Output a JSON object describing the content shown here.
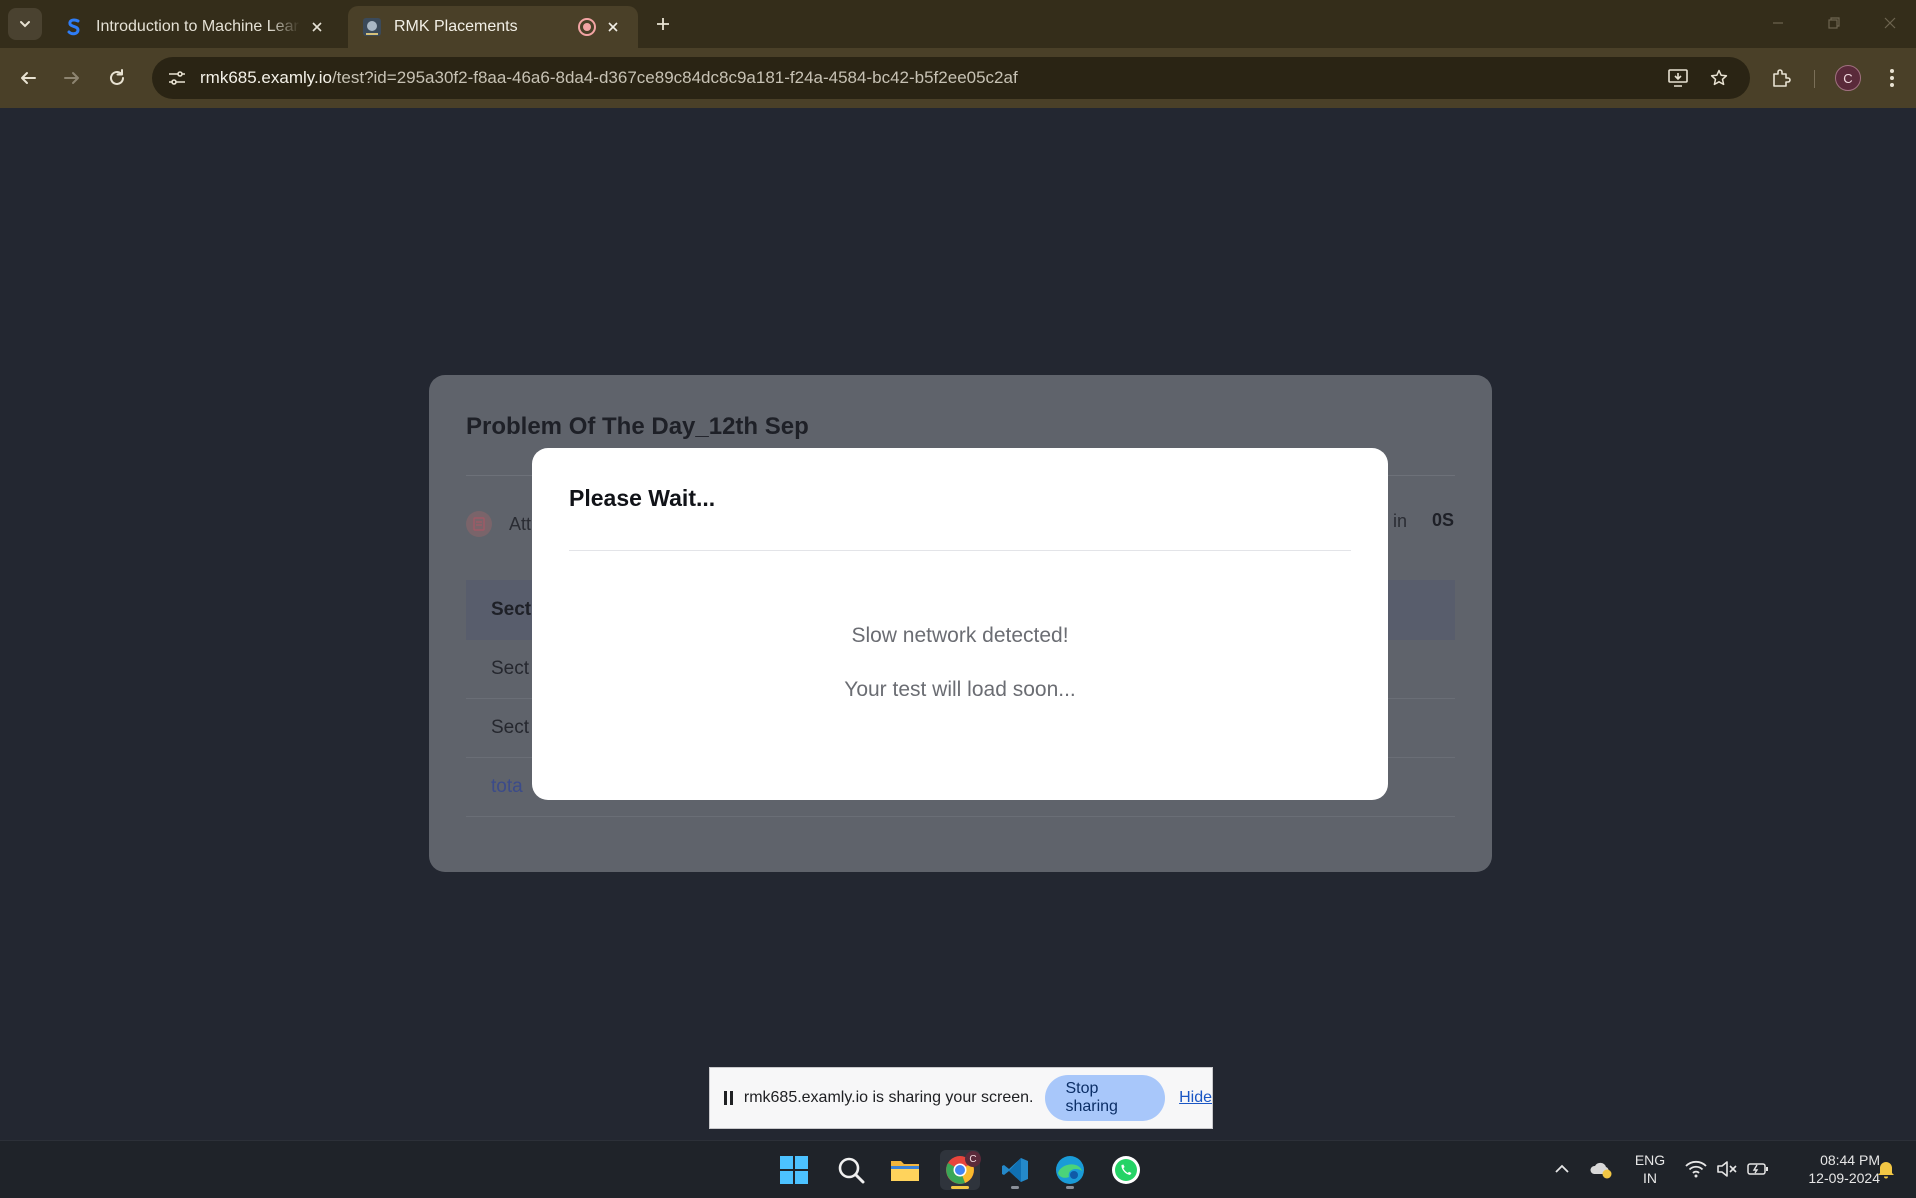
{
  "browser": {
    "tabs": [
      {
        "title": "Introduction to Machine Learnin",
        "favicon": "s-logo-icon"
      },
      {
        "title": "RMK Placements",
        "favicon": "college-logo-icon",
        "recording": true
      }
    ],
    "url": {
      "host": "rmk685.examly.io",
      "path": "/test?id=295a30f2-f8aa-46a6-8da4-d367ce89c84dc8c9a181-f24a-4584-bc42-b5f2ee05c2af"
    },
    "profile_initial": "C"
  },
  "page": {
    "card": {
      "title": "Problem Of The Day_12th Sep",
      "attempt_text": "Att",
      "ends_text": "s in",
      "ends_value": "0S",
      "table": {
        "header": "Sect",
        "rows": [
          "Sect",
          "Sect"
        ],
        "total": "tota"
      }
    },
    "modal": {
      "title": "Please Wait...",
      "message_1": "Slow network detected!",
      "message_2": "Your test will load soon..."
    }
  },
  "share_bar": {
    "text": "rmk685.examly.io is sharing your screen.",
    "stop_label": "Stop sharing",
    "hide_label": "Hide"
  },
  "taskbar": {
    "apps": [
      "windows-start-icon",
      "search-icon",
      "file-explorer-icon",
      "chrome-icon",
      "vscode-icon",
      "edge-icon",
      "whatsapp-icon"
    ],
    "chrome_badge": "C",
    "lang_line1": "ENG",
    "lang_line2": "IN",
    "time": "08:44 PM",
    "date": "12-09-2024"
  },
  "colors": {
    "tab_strip": "#342d1a",
    "toolbar": "#4a4028",
    "page_bg": "#232731",
    "stop_button": "#a8c7fa"
  }
}
